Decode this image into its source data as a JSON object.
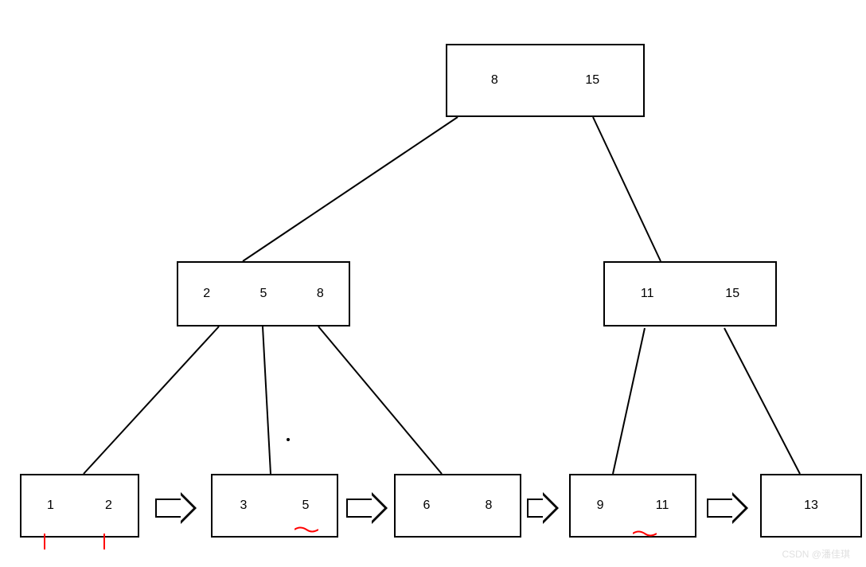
{
  "tree": {
    "root": {
      "values": [
        "8",
        "15"
      ]
    },
    "level1_left": {
      "values": [
        "2",
        "5",
        "8"
      ]
    },
    "level1_right": {
      "values": [
        "11",
        "15"
      ]
    },
    "leaf1": {
      "values": [
        "1",
        "2"
      ]
    },
    "leaf2": {
      "values": [
        "3",
        "5"
      ]
    },
    "leaf3": {
      "values": [
        "6",
        "8"
      ]
    },
    "leaf4": {
      "values": [
        "9",
        "11"
      ]
    },
    "leaf5": {
      "values": [
        "13"
      ]
    }
  },
  "watermark": "CSDN @潘佳琪",
  "chart_data": {
    "type": "diagram",
    "description": "B+ tree structure with linked leaf nodes",
    "root_node": [
      8,
      15
    ],
    "internal_nodes": [
      {
        "keys": [
          2,
          5,
          8
        ],
        "parent": "root"
      },
      {
        "keys": [
          11,
          15
        ],
        "parent": "root"
      }
    ],
    "leaf_nodes": [
      {
        "keys": [
          1,
          2
        ]
      },
      {
        "keys": [
          3,
          5
        ]
      },
      {
        "keys": [
          6,
          8
        ]
      },
      {
        "keys": [
          9,
          11
        ]
      },
      {
        "keys": [
          13
        ]
      }
    ],
    "leaf_linked_list": true
  }
}
